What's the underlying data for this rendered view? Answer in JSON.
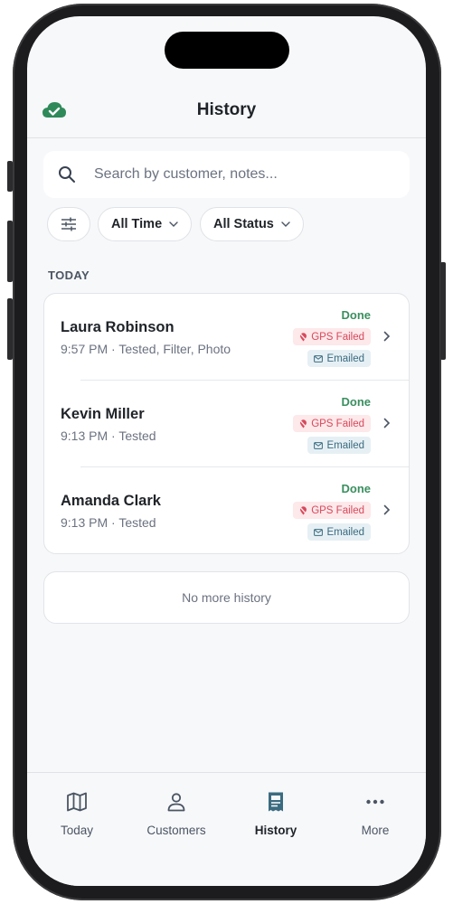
{
  "header": {
    "title": "History"
  },
  "search": {
    "placeholder": "Search by customer, notes..."
  },
  "filters": {
    "time": "All Time",
    "status": "All Status"
  },
  "section": {
    "label": "TODAY"
  },
  "entries": [
    {
      "name": "Laura Robinson",
      "sub": "9:57 PM · Tested, Filter, Photo",
      "status": "Done",
      "gps": "GPS Failed",
      "email": "Emailed"
    },
    {
      "name": "Kevin Miller",
      "sub": "9:13 PM · Tested",
      "status": "Done",
      "gps": "GPS Failed",
      "email": "Emailed"
    },
    {
      "name": "Amanda Clark",
      "sub": "9:13 PM · Tested",
      "status": "Done",
      "gps": "GPS Failed",
      "email": "Emailed"
    }
  ],
  "end_message": "No more history",
  "tabs": [
    {
      "label": "Today",
      "icon": "map-icon"
    },
    {
      "label": "Customers",
      "icon": "person-icon"
    },
    {
      "label": "History",
      "icon": "receipt-icon"
    },
    {
      "label": "More",
      "icon": "more-icon"
    }
  ],
  "colors": {
    "accent": "#2f8a5a",
    "done": "#3a8f5f",
    "gps_badge_bg": "#fde8ea",
    "gps_badge_text": "#d7495b",
    "email_badge_bg": "#e6f0f4",
    "email_badge_text": "#3b6b80",
    "active_tab_icon": "#3b6b80"
  }
}
